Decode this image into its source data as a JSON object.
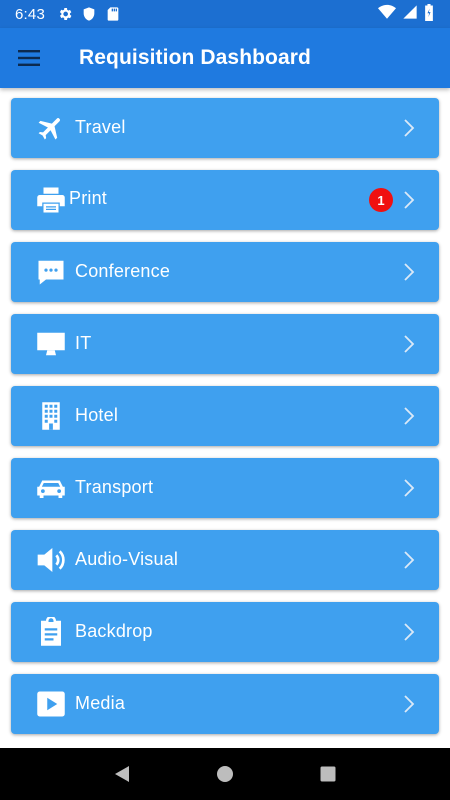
{
  "status_bar": {
    "time": "6:43",
    "left_icons": [
      "gear-icon",
      "shield-icon",
      "sd-card-icon"
    ],
    "right_icons": [
      "wifi-icon",
      "signal-icon",
      "battery-icon"
    ]
  },
  "app_bar": {
    "title": "Requisition Dashboard",
    "menu_icon": "hamburger-menu-icon"
  },
  "items": [
    {
      "label": "Travel",
      "icon": "airplane-icon",
      "badge": null
    },
    {
      "label": "Print",
      "icon": "printer-icon",
      "badge": "1"
    },
    {
      "label": "Conference",
      "icon": "chat-bubble-icon",
      "badge": null
    },
    {
      "label": "IT",
      "icon": "monitor-icon",
      "badge": null
    },
    {
      "label": "Hotel",
      "icon": "building-icon",
      "badge": null
    },
    {
      "label": "Transport",
      "icon": "car-icon",
      "badge": null
    },
    {
      "label": "Audio-Visual",
      "icon": "speaker-icon",
      "badge": null
    },
    {
      "label": "Backdrop",
      "icon": "clipboard-icon",
      "badge": null
    },
    {
      "label": "Media",
      "icon": "play-icon",
      "badge": null
    }
  ],
  "colors": {
    "status_bar": "#1c6fd1",
    "app_bar": "#1f7ae0",
    "card": "#3fa0ef",
    "badge": "#f01010",
    "nav_bar": "#000000"
  },
  "nav_bar": {
    "buttons": [
      "back-icon",
      "home-icon",
      "recents-icon"
    ]
  }
}
